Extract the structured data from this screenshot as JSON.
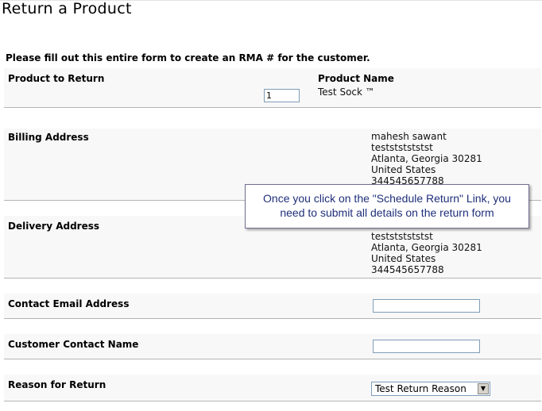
{
  "page": {
    "title": "Return a Product",
    "instructions": "Please fill out this entire form to create an RMA # for the customer."
  },
  "product": {
    "label": "Product to Return",
    "quantity": "1",
    "name_header": "Product Name",
    "name": "Test Sock ™"
  },
  "billing": {
    "label": "Billing Address",
    "lines": [
      "mahesh sawant",
      "testststststst",
      "Atlanta, Georgia 30281",
      "United States",
      "344545657788"
    ]
  },
  "delivery": {
    "label": "Delivery Address",
    "lines": [
      "testststststst",
      "Atlanta, Georgia 30281",
      "United States",
      "344545657788"
    ]
  },
  "contact_email": {
    "label": "Contact Email Address",
    "value": ""
  },
  "contact_name": {
    "label": "Customer Contact Name",
    "value": ""
  },
  "reason": {
    "label": "Reason for Return",
    "selected": "Test Return Reason"
  },
  "tooltip": {
    "line1": "Once you click on the \"Schedule Return\" Link, you",
    "line2": "need to submit all details on the return form"
  }
}
